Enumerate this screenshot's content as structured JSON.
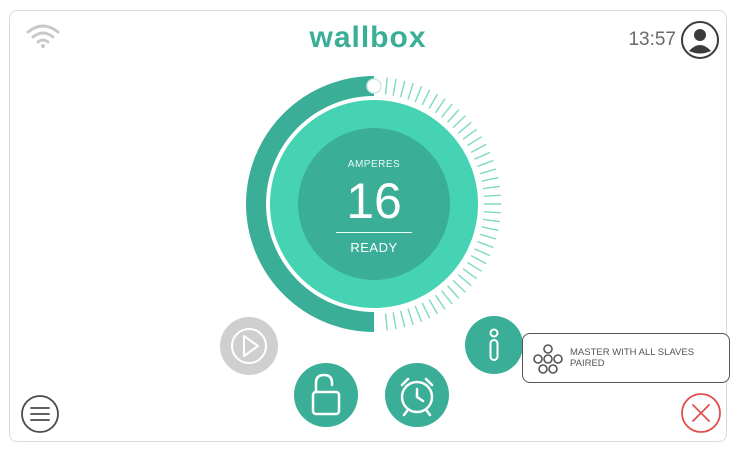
{
  "header": {
    "brand": "wallbox",
    "time": "13:57",
    "wifi_icon": "wifi-icon",
    "user_icon": "user-avatar-icon"
  },
  "gauge": {
    "label": "AMPERES",
    "value": "16",
    "status": "READY",
    "level": 0.5
  },
  "status_card": {
    "text": "MASTER WITH ALL SLAVES PAIRED",
    "icon": "pairing-nodes-icon"
  },
  "controls": {
    "play_icon": "play-icon",
    "lock_icon": "unlock-icon",
    "alarm_icon": "alarm-clock-icon",
    "info_icon": "info-icon",
    "menu_icon": "menu-icon",
    "close_icon": "close-icon"
  },
  "colors": {
    "brand": "#3aae96",
    "accent": "#45d3b3",
    "disabled": "#cfcfcf",
    "danger": "#e05050"
  }
}
